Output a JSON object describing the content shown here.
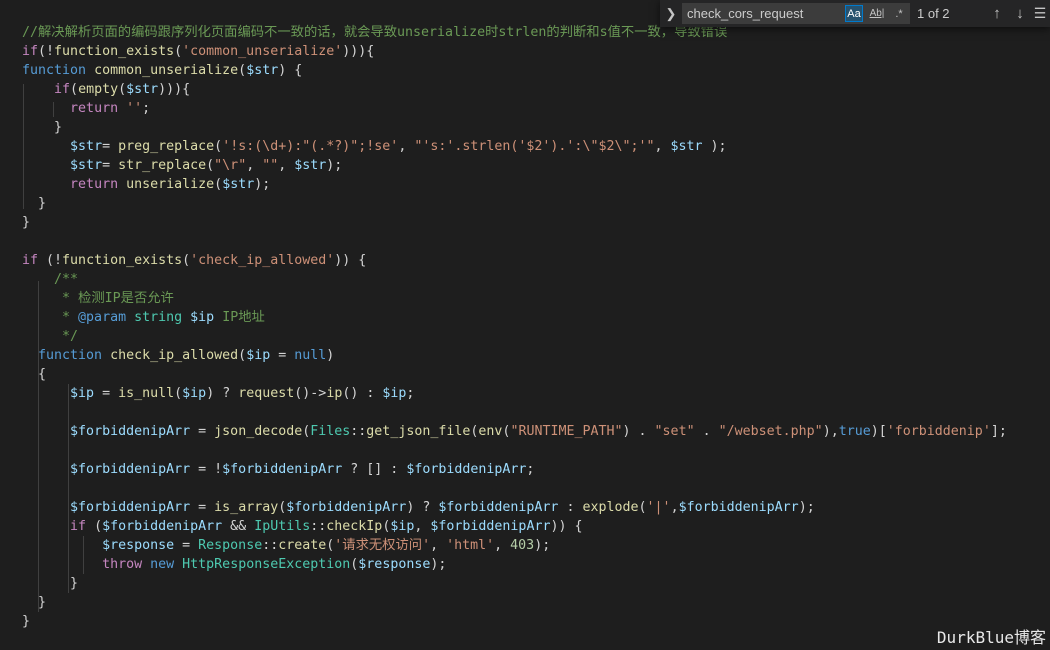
{
  "find_widget": {
    "query": "check_cors_request",
    "match_case_label": "Aa",
    "match_word_label": "Ab|",
    "regex_label": ".*",
    "match_count": "1 of 2",
    "toggle_icon": "chevron-right",
    "prev_icon": "arrow-up",
    "next_icon": "arrow-down",
    "menu_icon": "hamburger-menu",
    "match_case_active": true
  },
  "watermark": "DurkBlue博客",
  "colors": {
    "background": "#1e1e1e",
    "comment": "#6a9955",
    "keyword": "#569cd6",
    "control": "#c586c0",
    "function": "#dcdcaa",
    "string": "#ce9178",
    "variable": "#9cdcfe",
    "class": "#4ec9b0",
    "number": "#b5cea8",
    "accent": "#007acc"
  },
  "code_lines": [
    [
      [
        "cm",
        "//解决解析页面的编码跟序列化页面编码不一致的话，就会导致unserialize时strlen的判断和s值不一致，导致错误"
      ]
    ],
    [
      [
        "ctl",
        "if"
      ],
      [
        "pl",
        "(!"
      ],
      [
        "fn",
        "function_exists"
      ],
      [
        "pl",
        "("
      ],
      [
        "str",
        "'common_unserialize'"
      ],
      [
        "pl",
        "))){"
      ]
    ],
    [
      [
        "kw",
        "function"
      ],
      [
        "pl",
        " "
      ],
      [
        "fn",
        "common_unserialize"
      ],
      [
        "pl",
        "("
      ],
      [
        "var",
        "$str"
      ],
      [
        "pl",
        ") {"
      ]
    ],
    [
      [
        "pl",
        "    "
      ],
      [
        "ctl",
        "if"
      ],
      [
        "pl",
        "("
      ],
      [
        "fn",
        "empty"
      ],
      [
        "pl",
        "("
      ],
      [
        "var",
        "$str"
      ],
      [
        "pl",
        "))){"
      ]
    ],
    [
      [
        "pl",
        "      "
      ],
      [
        "ctl",
        "return"
      ],
      [
        "pl",
        " "
      ],
      [
        "str",
        "''"
      ],
      [
        "pl",
        ";"
      ]
    ],
    [
      [
        "pl",
        "    }"
      ]
    ],
    [
      [
        "pl",
        "      "
      ],
      [
        "var",
        "$str"
      ],
      [
        "pl",
        "= "
      ],
      [
        "fn",
        "preg_replace"
      ],
      [
        "pl",
        "("
      ],
      [
        "str",
        "'!s:(\\d+):\"(.*?)\";!se'"
      ],
      [
        "pl",
        ", "
      ],
      [
        "str",
        "\"'s:'.strlen('$2').':\\\"$2\\\";'\""
      ],
      [
        "pl",
        ", "
      ],
      [
        "var",
        "$str"
      ],
      [
        "pl",
        " );"
      ]
    ],
    [
      [
        "pl",
        "      "
      ],
      [
        "var",
        "$str"
      ],
      [
        "pl",
        "= "
      ],
      [
        "fn",
        "str_replace"
      ],
      [
        "pl",
        "("
      ],
      [
        "str",
        "\"\\r\""
      ],
      [
        "pl",
        ", "
      ],
      [
        "str",
        "\"\""
      ],
      [
        "pl",
        ", "
      ],
      [
        "var",
        "$str"
      ],
      [
        "pl",
        ");"
      ]
    ],
    [
      [
        "pl",
        "      "
      ],
      [
        "ctl",
        "return"
      ],
      [
        "pl",
        " "
      ],
      [
        "fn",
        "unserialize"
      ],
      [
        "pl",
        "("
      ],
      [
        "var",
        "$str"
      ],
      [
        "pl",
        ");"
      ]
    ],
    [
      [
        "pl",
        "  }"
      ]
    ],
    [
      [
        "pl",
        "}"
      ]
    ],
    [],
    [
      [
        "ctl",
        "if"
      ],
      [
        "pl",
        " (!"
      ],
      [
        "fn",
        "function_exists"
      ],
      [
        "pl",
        "("
      ],
      [
        "str",
        "'check_ip_allowed'"
      ],
      [
        "pl",
        ")) {"
      ]
    ],
    [
      [
        "pl",
        "    "
      ],
      [
        "cm",
        "/**"
      ]
    ],
    [
      [
        "pl",
        "     "
      ],
      [
        "cm",
        "* 检测IP是否允许"
      ]
    ],
    [
      [
        "pl",
        "     "
      ],
      [
        "cm",
        "* "
      ],
      [
        "kw",
        "@param"
      ],
      [
        "pl",
        " "
      ],
      [
        "cls",
        "string"
      ],
      [
        "pl",
        " "
      ],
      [
        "var",
        "$ip"
      ],
      [
        "cm",
        " IP地址"
      ]
    ],
    [
      [
        "pl",
        "     "
      ],
      [
        "cm",
        "*/"
      ]
    ],
    [
      [
        "pl",
        "  "
      ],
      [
        "kw",
        "function"
      ],
      [
        "pl",
        " "
      ],
      [
        "fn",
        "check_ip_allowed"
      ],
      [
        "pl",
        "("
      ],
      [
        "var",
        "$ip"
      ],
      [
        "pl",
        " = "
      ],
      [
        "kw",
        "null"
      ],
      [
        "pl",
        ")"
      ]
    ],
    [
      [
        "pl",
        "  {"
      ]
    ],
    [
      [
        "pl",
        "      "
      ],
      [
        "var",
        "$ip"
      ],
      [
        "pl",
        " = "
      ],
      [
        "fn",
        "is_null"
      ],
      [
        "pl",
        "("
      ],
      [
        "var",
        "$ip"
      ],
      [
        "pl",
        ") ? "
      ],
      [
        "fn",
        "request"
      ],
      [
        "pl",
        "()->"
      ],
      [
        "fn",
        "ip"
      ],
      [
        "pl",
        "() : "
      ],
      [
        "var",
        "$ip"
      ],
      [
        "pl",
        ";"
      ]
    ],
    [],
    [
      [
        "pl",
        "      "
      ],
      [
        "var",
        "$forbiddenipArr"
      ],
      [
        "pl",
        " = "
      ],
      [
        "fn",
        "json_decode"
      ],
      [
        "pl",
        "("
      ],
      [
        "cls",
        "Files"
      ],
      [
        "pl",
        "::"
      ],
      [
        "fn",
        "get_json_file"
      ],
      [
        "pl",
        "("
      ],
      [
        "fn",
        "env"
      ],
      [
        "pl",
        "("
      ],
      [
        "str",
        "\"RUNTIME_PATH\""
      ],
      [
        "pl",
        ") . "
      ],
      [
        "str",
        "\"set\""
      ],
      [
        "pl",
        " . "
      ],
      [
        "str",
        "\"/webset.php\""
      ],
      [
        "pl",
        "),"
      ],
      [
        "kw",
        "true"
      ],
      [
        "pl",
        ")["
      ],
      [
        "str",
        "'forbiddenip'"
      ],
      [
        "pl",
        "];"
      ]
    ],
    [],
    [
      [
        "pl",
        "      "
      ],
      [
        "var",
        "$forbiddenipArr"
      ],
      [
        "pl",
        " = !"
      ],
      [
        "var",
        "$forbiddenipArr"
      ],
      [
        "pl",
        " ? [] : "
      ],
      [
        "var",
        "$forbiddenipArr"
      ],
      [
        "pl",
        ";"
      ]
    ],
    [],
    [
      [
        "pl",
        "      "
      ],
      [
        "var",
        "$forbiddenipArr"
      ],
      [
        "pl",
        " = "
      ],
      [
        "fn",
        "is_array"
      ],
      [
        "pl",
        "("
      ],
      [
        "var",
        "$forbiddenipArr"
      ],
      [
        "pl",
        ") ? "
      ],
      [
        "var",
        "$forbiddenipArr"
      ],
      [
        "pl",
        " : "
      ],
      [
        "fn",
        "explode"
      ],
      [
        "pl",
        "("
      ],
      [
        "str",
        "'|'"
      ],
      [
        "pl",
        ","
      ],
      [
        "var",
        "$forbiddenipArr"
      ],
      [
        "pl",
        ");"
      ]
    ],
    [
      [
        "pl",
        "      "
      ],
      [
        "ctl",
        "if"
      ],
      [
        "pl",
        " ("
      ],
      [
        "var",
        "$forbiddenipArr"
      ],
      [
        "pl",
        " && "
      ],
      [
        "cls",
        "IpUtils"
      ],
      [
        "pl",
        "::"
      ],
      [
        "fn",
        "checkIp"
      ],
      [
        "pl",
        "("
      ],
      [
        "var",
        "$ip"
      ],
      [
        "pl",
        ", "
      ],
      [
        "var",
        "$forbiddenipArr"
      ],
      [
        "pl",
        ")) {"
      ]
    ],
    [
      [
        "pl",
        "          "
      ],
      [
        "var",
        "$response"
      ],
      [
        "pl",
        " = "
      ],
      [
        "cls",
        "Response"
      ],
      [
        "pl",
        "::"
      ],
      [
        "fn",
        "create"
      ],
      [
        "pl",
        "("
      ],
      [
        "str",
        "'请求无权访问'"
      ],
      [
        "pl",
        ", "
      ],
      [
        "str",
        "'html'"
      ],
      [
        "pl",
        ", "
      ],
      [
        "num",
        "403"
      ],
      [
        "pl",
        ");"
      ]
    ],
    [
      [
        "pl",
        "          "
      ],
      [
        "ctl",
        "throw"
      ],
      [
        "pl",
        " "
      ],
      [
        "kw",
        "new"
      ],
      [
        "pl",
        " "
      ],
      [
        "cls",
        "HttpResponseException"
      ],
      [
        "pl",
        "("
      ],
      [
        "var",
        "$response"
      ],
      [
        "pl",
        ");"
      ]
    ],
    [
      [
        "pl",
        "      }"
      ]
    ],
    [
      [
        "pl",
        "  }"
      ]
    ],
    [
      [
        "pl",
        "}"
      ]
    ]
  ]
}
